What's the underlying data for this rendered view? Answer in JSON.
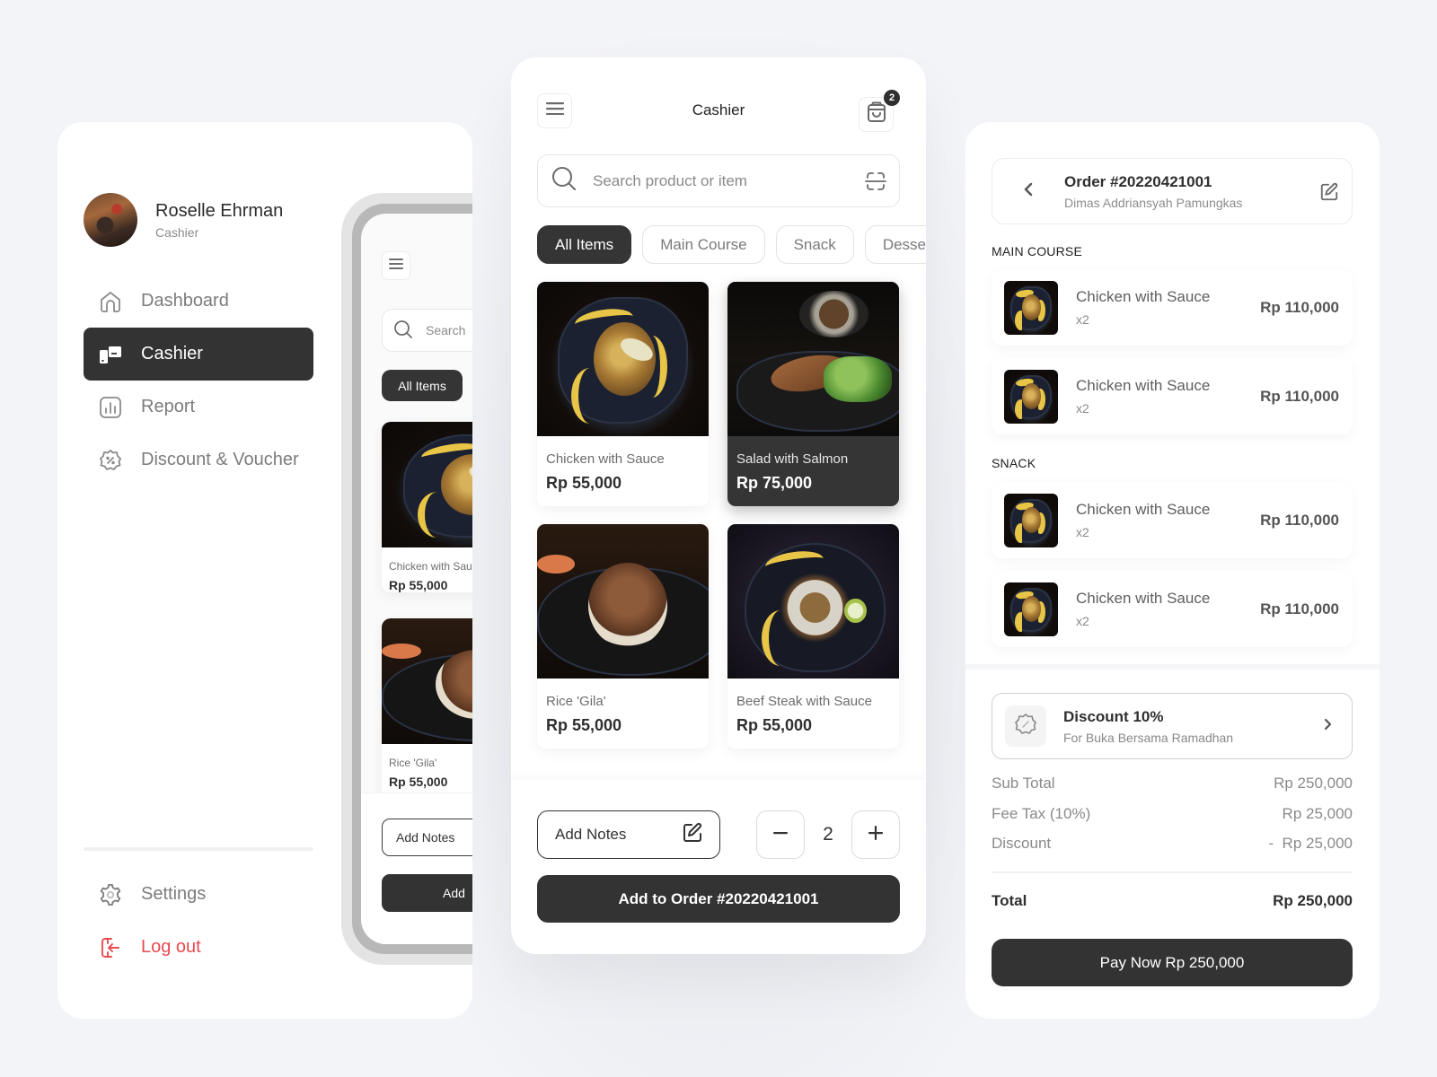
{
  "sidebar": {
    "user": {
      "name": "Roselle Ehrman",
      "role": "Cashier"
    },
    "nav": [
      {
        "label": "Dashboard",
        "icon": "home-icon",
        "active": false
      },
      {
        "label": "Cashier",
        "icon": "cashier-icon",
        "active": true
      },
      {
        "label": "Report",
        "icon": "report-chart-icon",
        "active": false
      },
      {
        "label": "Discount & Voucher",
        "icon": "discount-badge-icon",
        "active": false
      }
    ],
    "bottom_nav": [
      {
        "label": "Settings",
        "icon": "gear-icon"
      },
      {
        "label": "Log out",
        "icon": "logout-icon"
      }
    ],
    "logout_color": "#e84a4f"
  },
  "mobile_preview": {
    "search_placeholder": "Search",
    "chip_label": "All Items",
    "cards": [
      {
        "name": "Chicken with Sauce",
        "price": "Rp 55,000"
      },
      {
        "name": "Rice 'Gila'",
        "price": "Rp 55,000"
      }
    ],
    "notes_label": "Add Notes",
    "add_label": "Add"
  },
  "cashier": {
    "title": "Cashier",
    "cart_count": "2",
    "search_placeholder": "Search product or item",
    "categories": [
      {
        "label": "All Items",
        "active": true
      },
      {
        "label": "Main Course",
        "active": false
      },
      {
        "label": "Snack",
        "active": false
      },
      {
        "label": "Dessert",
        "active": false
      }
    ],
    "products": [
      {
        "name": "Chicken with Sauce",
        "price": "Rp 55,000",
        "selected": false,
        "image": "chicken"
      },
      {
        "name": "Salad with Salmon",
        "price": "Rp 75,000",
        "selected": true,
        "image": "salad"
      },
      {
        "name": "Rice 'Gila'",
        "price": "Rp 55,000",
        "selected": false,
        "image": "rice"
      },
      {
        "name": "Beef Steak with Sauce",
        "price": "Rp 55,000",
        "selected": false,
        "image": "beef"
      }
    ],
    "notes_label": "Add Notes",
    "quantity": "2",
    "add_to_order_label": "Add to Order #20220421001"
  },
  "order": {
    "title": "Order #20220421001",
    "customer": "Dimas Addriansyah Pamungkas",
    "sections": [
      {
        "label": "MAIN COURSE",
        "items": [
          {
            "name": "Chicken with Sauce",
            "qty": "x2",
            "price": "Rp 110,000"
          },
          {
            "name": "Chicken with Sauce",
            "qty": "x2",
            "price": "Rp 110,000"
          }
        ]
      },
      {
        "label": "SNACK",
        "items": [
          {
            "name": "Chicken with Sauce",
            "qty": "x2",
            "price": "Rp 110,000"
          },
          {
            "name": "Chicken with Sauce",
            "qty": "x2",
            "price": "Rp 110,000"
          }
        ]
      }
    ],
    "discount": {
      "title": "Discount 10%",
      "subtitle": "For Buka Bersama Ramadhan"
    },
    "summary": [
      {
        "label": "Sub Total",
        "value": "Rp 250,000"
      },
      {
        "label": "Fee Tax (10%)",
        "value": "Rp 25,000"
      },
      {
        "label": "Discount",
        "value": "-  Rp 25,000"
      }
    ],
    "total_label": "Total",
    "total_value": "Rp 250,000",
    "pay_label": "Pay Now Rp 250,000"
  }
}
